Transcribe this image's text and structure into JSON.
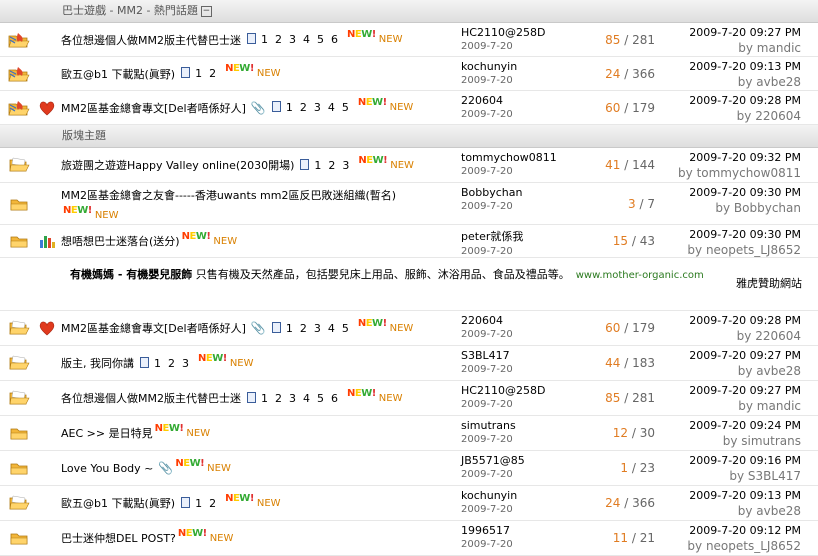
{
  "hot_section": {
    "title": "巴士遊戲 - MM2 - 熱門話題",
    "collapse_glyph": "−"
  },
  "hot_rows": [
    {
      "icon": "hot-folder",
      "extra_icon": "",
      "title": "各位想邊個人做MM2版主代替巴士迷",
      "pages": [
        "1",
        "2",
        "3",
        "4",
        "5",
        "6"
      ],
      "attachment": false,
      "author": "HC2110@258D",
      "date": "2009-7-20",
      "replies": "85",
      "views": "281",
      "last_time": "2009-7-20 09:27 PM",
      "last_by": "by mandic"
    },
    {
      "icon": "hot-folder",
      "extra_icon": "",
      "title": "歐五@b1 下載點(眞野)",
      "pages": [
        "1",
        "2"
      ],
      "attachment": false,
      "author": "kochunyin",
      "date": "2009-7-20",
      "replies": "24",
      "views": "366",
      "last_time": "2009-7-20 09:13 PM",
      "last_by": "by avbe28"
    },
    {
      "icon": "hot-folder",
      "extra_icon": "heart",
      "title": "MM2區基金總會專文[Del者唔係好人]",
      "pages": [
        "1",
        "2",
        "3",
        "4",
        "5"
      ],
      "attachment": true,
      "author": "220604",
      "date": "2009-7-20",
      "replies": "60",
      "views": "179",
      "last_time": "2009-7-20 09:28 PM",
      "last_by": "by 220604"
    }
  ],
  "board_section": {
    "title": "版塊主題"
  },
  "board_rows": [
    {
      "icon": "open-folder",
      "extra_icon": "",
      "title": "旅遊團之遊遊Happy Valley online(2030開場)",
      "pages": [
        "1",
        "2",
        "3"
      ],
      "attachment": false,
      "author": "tommychow0811",
      "date": "2009-7-20",
      "replies": "41",
      "views": "144",
      "last_time": "2009-7-20 09:32 PM",
      "last_by": "by tommychow0811"
    },
    {
      "icon": "folder",
      "extra_icon": "",
      "title": "MM2區基金總會之友會-----香港uwants mm2區反巴敗迷組織(暫名)",
      "pages": [],
      "attachment": false,
      "wrap": true,
      "author": "Bobbychan",
      "date": "2009-7-20",
      "replies": "3",
      "views": "7",
      "last_time": "2009-7-20 09:30 PM",
      "last_by": "by Bobbychan"
    },
    {
      "icon": "folder",
      "extra_icon": "chart",
      "title": "想唔想巴士迷落台(送分)",
      "pages": [],
      "attachment": false,
      "author": "peter就係我",
      "date": "2009-7-20",
      "replies": "15",
      "views": "43",
      "last_time": "2009-7-20 09:30 PM",
      "last_by": "by neopets_LJ8652"
    }
  ],
  "ad": {
    "brand": "有機媽媽 - 有機嬰兒服飾",
    "text": " 只售有機及天然產品，包括嬰兒床上用品、服飾、沐浴用品、食品及禮品等。",
    "url": "www.mother-organic.com",
    "sponsor": "雅虎贊助網站"
  },
  "lower_rows": [
    {
      "icon": "open-folder",
      "extra_icon": "heart",
      "title": "MM2區基金總會專文[Del者唔係好人]",
      "pages": [
        "1",
        "2",
        "3",
        "4",
        "5"
      ],
      "attachment": true,
      "author": "220604",
      "date": "2009-7-20",
      "replies": "60",
      "views": "179",
      "last_time": "2009-7-20 09:28 PM",
      "last_by": "by 220604"
    },
    {
      "icon": "open-folder",
      "extra_icon": "",
      "title": "版主, 我同你講",
      "pages": [
        "1",
        "2",
        "3"
      ],
      "attachment": false,
      "author": "S3BL417",
      "date": "2009-7-20",
      "replies": "44",
      "views": "183",
      "last_time": "2009-7-20 09:27 PM",
      "last_by": "by avbe28"
    },
    {
      "icon": "open-folder",
      "extra_icon": "",
      "title": "各位想邊個人做MM2版主代替巴士迷",
      "pages": [
        "1",
        "2",
        "3",
        "4",
        "5",
        "6"
      ],
      "attachment": false,
      "author": "HC2110@258D",
      "date": "2009-7-20",
      "replies": "85",
      "views": "281",
      "last_time": "2009-7-20 09:27 PM",
      "last_by": "by mandic"
    },
    {
      "icon": "folder",
      "extra_icon": "",
      "title": "AEC >> 是日特見",
      "pages": [],
      "attachment": false,
      "author": "simutrans",
      "date": "2009-7-20",
      "replies": "12",
      "views": "30",
      "last_time": "2009-7-20 09:24 PM",
      "last_by": "by simutrans"
    },
    {
      "icon": "folder",
      "extra_icon": "",
      "title": "Love You Body ~",
      "pages": [],
      "attachment": true,
      "author": "JB5571@85",
      "date": "2009-7-20",
      "replies": "1",
      "views": "23",
      "last_time": "2009-7-20 09:16 PM",
      "last_by": "by S3BL417"
    },
    {
      "icon": "open-folder",
      "extra_icon": "",
      "title": "歐五@b1 下載點(眞野)",
      "pages": [
        "1",
        "2"
      ],
      "attachment": false,
      "author": "kochunyin",
      "date": "2009-7-20",
      "replies": "24",
      "views": "366",
      "last_time": "2009-7-20 09:13 PM",
      "last_by": "by avbe28"
    },
    {
      "icon": "folder",
      "extra_icon": "",
      "title": "巴士迷仲想DEL POST?",
      "pages": [],
      "attachment": false,
      "author": "1996517",
      "date": "2009-7-20",
      "replies": "11",
      "views": "21",
      "last_time": "2009-7-20 09:12 PM",
      "last_by": "by neopets_LJ8652"
    }
  ],
  "labels": {
    "new_word": "NEW!",
    "new_text": "NEW",
    "sep": " / "
  },
  "colors": {
    "folder": "#f2b63a",
    "hot_flame": "#e0462a",
    "heart": "#e03a1e",
    "replies": "#e07c22"
  }
}
